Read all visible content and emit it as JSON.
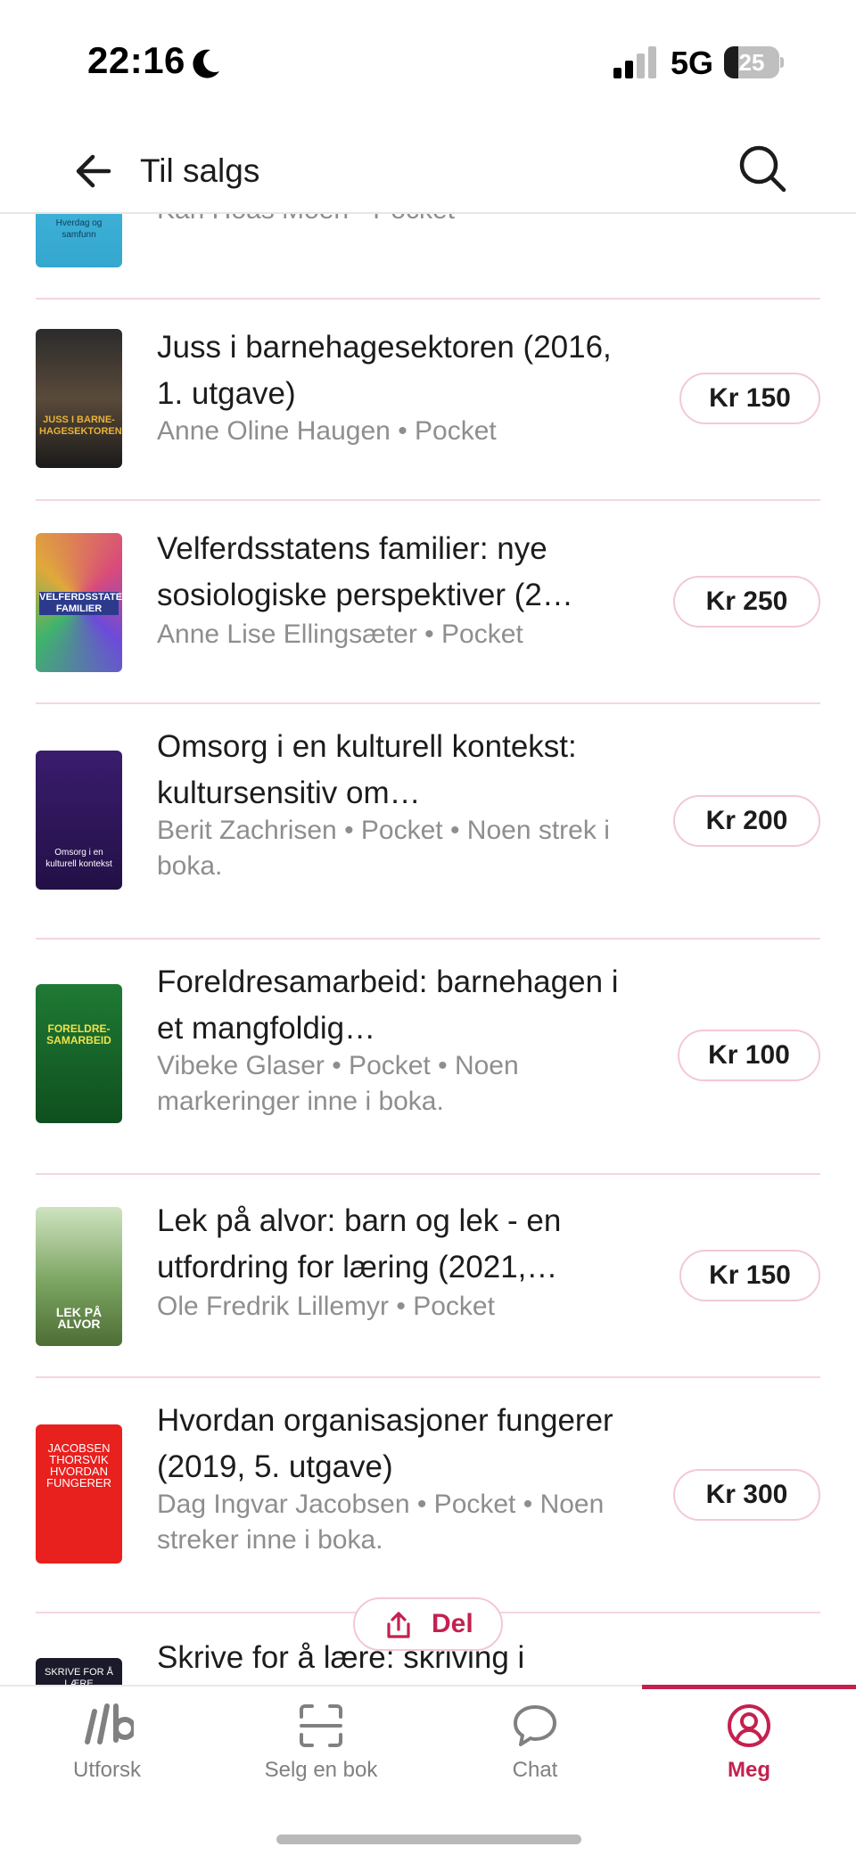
{
  "status_bar": {
    "time": "22:16",
    "network": "5G",
    "battery": "25",
    "battery_level": 0.25
  },
  "header": {
    "title": "Til salgs"
  },
  "listings": [
    {
      "title": "",
      "meta": "Kari Hoås Moen • Pocket",
      "price": "",
      "cover_text": "Hverdag og samfunn"
    },
    {
      "title": "Juss i barnehagesektoren (2016, 1. utgave)",
      "meta": "Anne Oline Haugen • Pocket",
      "price": "Kr 150",
      "cover_text": "JUSS I BARNE-HAGESEKTOREN"
    },
    {
      "title": "Velferdsstatens familier: nye sosiologiske perspektiver (2…",
      "meta": "Anne Lise Ellingsæter • Pocket",
      "price": "Kr 250",
      "cover_text": "VELFERDSSTATENS FAMILIER"
    },
    {
      "title": "Omsorg i en kulturell kontekst: kultursensitiv om…",
      "meta": "Berit Zachrisen • Pocket • Noen strek i boka.",
      "price": "Kr 200",
      "cover_text": "Omsorg i en kulturell kontekst"
    },
    {
      "title": "Foreldresamarbeid: barnehagen i et mangfoldig…",
      "meta": "Vibeke Glaser • Pocket • Noen markeringer inne i boka.",
      "price": "Kr 100",
      "cover_text": "FORELDRE-SAMARBEID"
    },
    {
      "title": "Lek på alvor: barn og lek - en utfordring for læring (2021,…",
      "meta": "Ole Fredrik Lillemyr • Pocket",
      "price": "Kr 150",
      "cover_text": "LEK PÅ ALVOR"
    },
    {
      "title": "Hvordan organisasjoner fungerer (2019, 5. utgave)",
      "meta": "Dag Ingvar Jacobsen • Pocket • Noen streker inne i boka.",
      "price": "Kr 300",
      "cover_text": "JACOBSEN THORSVIK HVORDAN FUNGERER"
    },
    {
      "title": "Skrive for å lære: skriving i",
      "meta": "",
      "price": "",
      "cover_text": "SKRIVE FOR Å LÆRE"
    }
  ],
  "share_button": {
    "label": "Del"
  },
  "tabs": [
    {
      "label": "Utforsk",
      "icon": "logo-icon"
    },
    {
      "label": "Selg en bok",
      "icon": "scan-icon"
    },
    {
      "label": "Chat",
      "icon": "chat-bubble-icon"
    },
    {
      "label": "Meg",
      "icon": "profile-icon",
      "active": true
    }
  ],
  "colors": {
    "accent": "#c4214f",
    "price_border": "#f2c9d3",
    "divider": "#f5d6dd",
    "muted_text": "#8e8e8e"
  }
}
